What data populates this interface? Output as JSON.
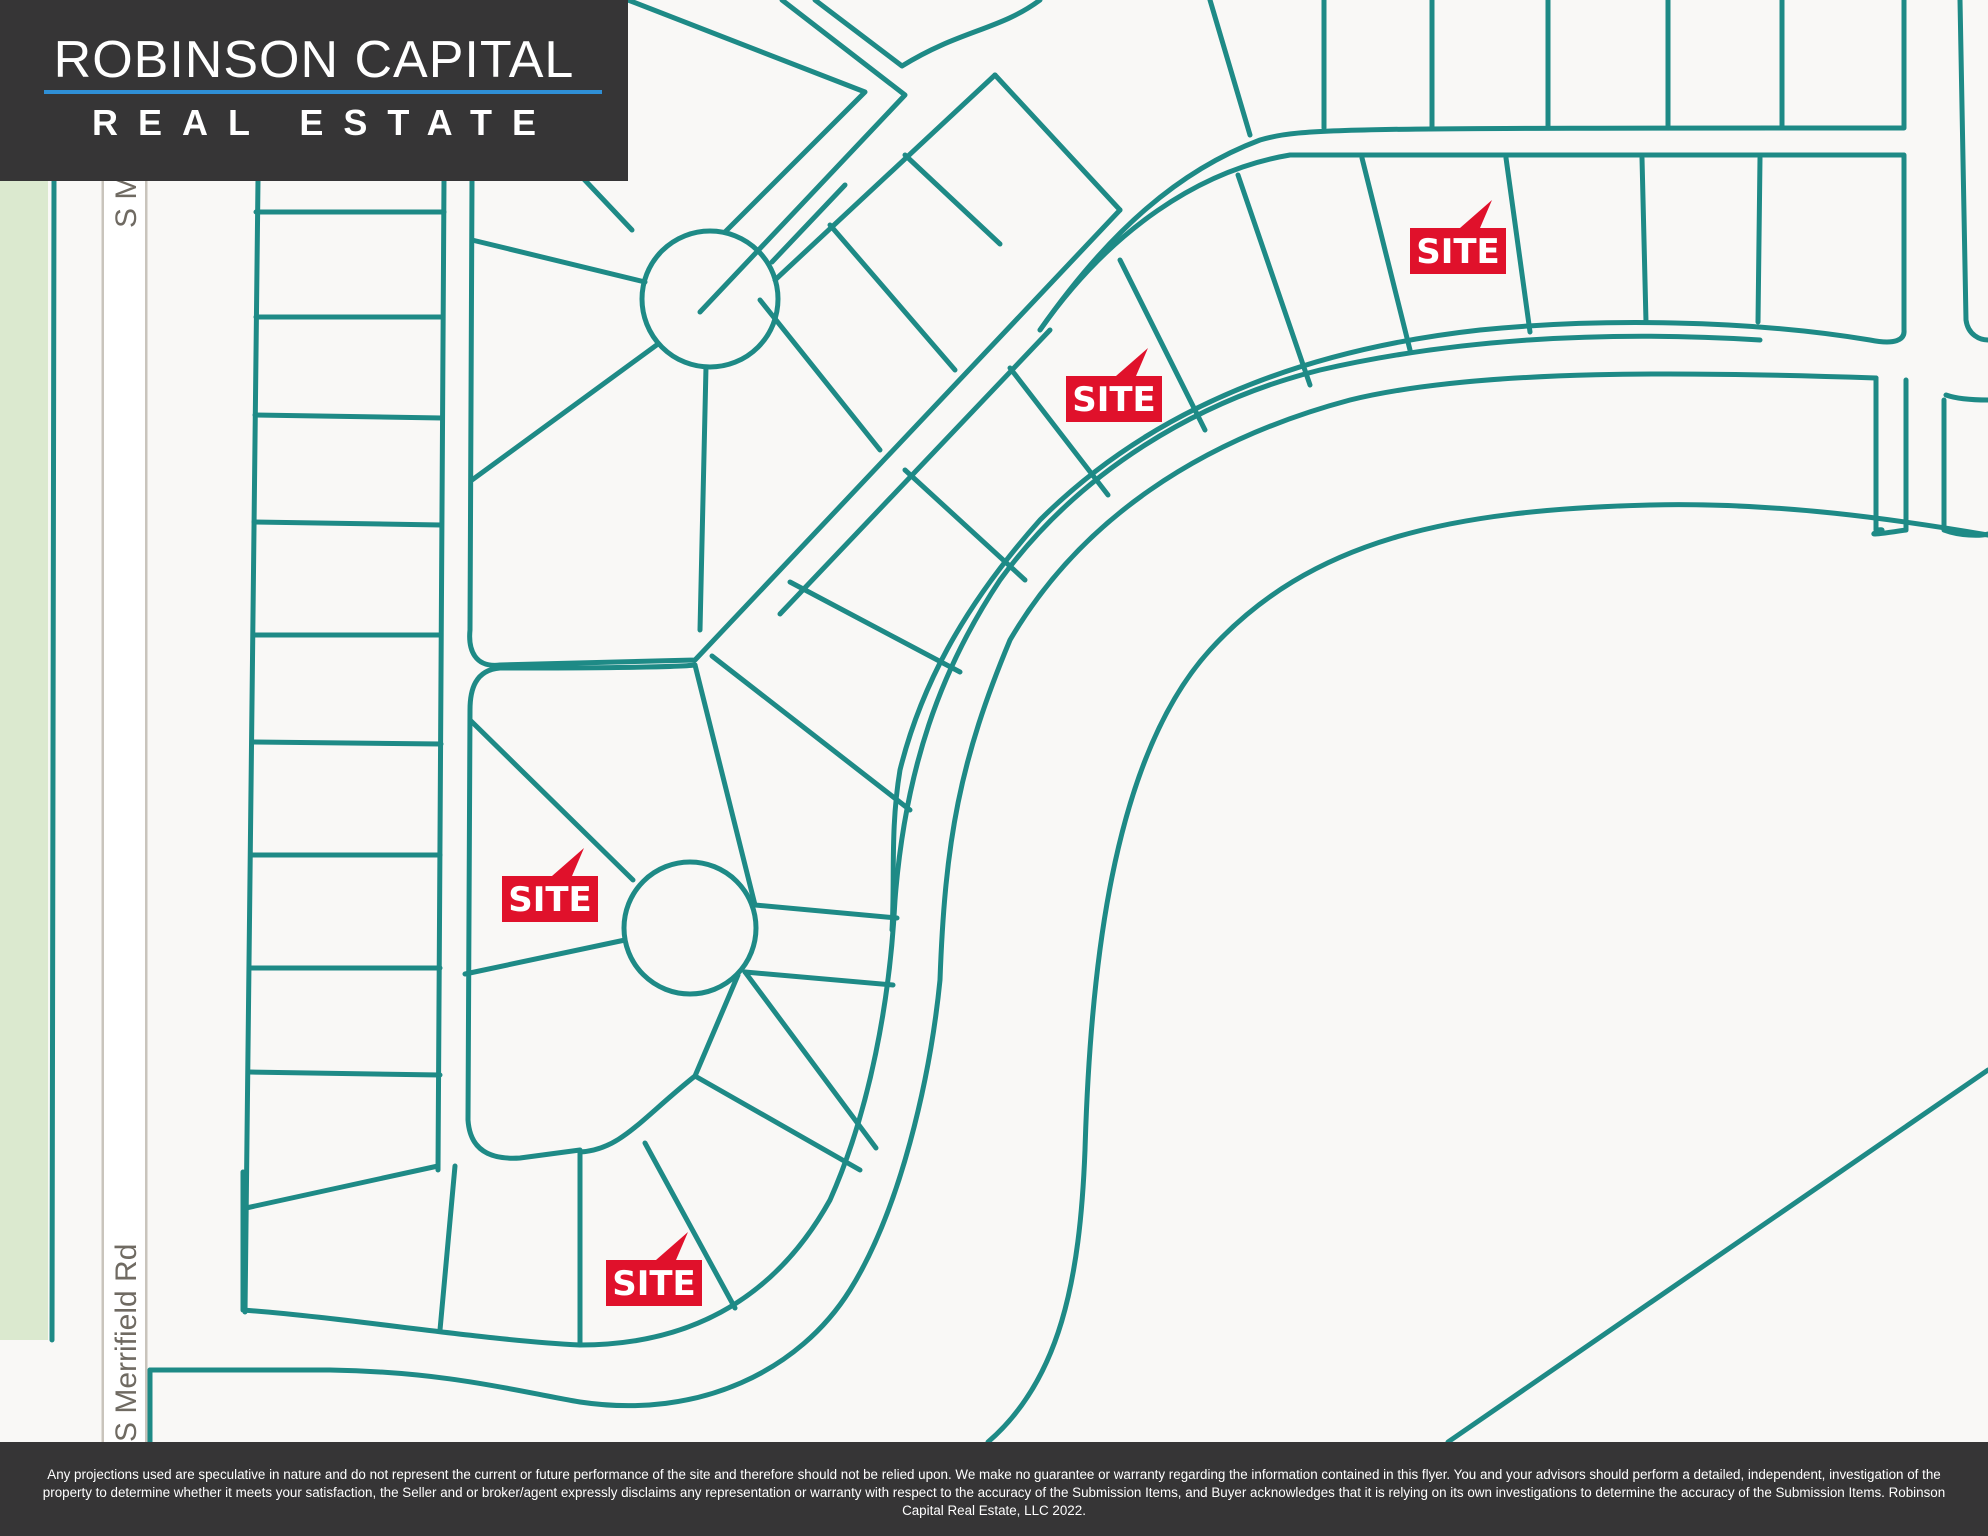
{
  "logo": {
    "brand": "ROBINSON CAPITAL",
    "subtitle": "REAL ESTATE"
  },
  "map": {
    "road_labels": {
      "s_merrifield": "S Merrifield Rd",
      "s_m_partial": "S M"
    },
    "site_markers": [
      {
        "label": "SITE"
      },
      {
        "label": "SITE"
      },
      {
        "label": "SITE"
      },
      {
        "label": "SITE"
      }
    ],
    "colors": {
      "lot_lines": "#1e8a86",
      "site_badge": "#e0112b",
      "park_strip": "#dbe9cf",
      "background": "#f9f8f6",
      "header_footer": "#363536",
      "logo_rule": "#2f8fd6"
    }
  },
  "footer": {
    "disclaimer": "Any projections used are speculative in nature and do not represent the current or future performance of the site and therefore should not be relied upon. We make no guarantee or warranty regarding the information contained in this flyer. You and your advisors should perform a detailed, independent, investigation of the property to determine whether it meets your satisfaction, the Seller and or broker/agent expressly disclaims any representation or warranty with respect to the accuracy of the Submission Items, and Buyer acknowledges that it is relying on its own investigations to determine the accuracy of the Submission Items. Robinson Capital Real Estate, LLC 2022."
  }
}
